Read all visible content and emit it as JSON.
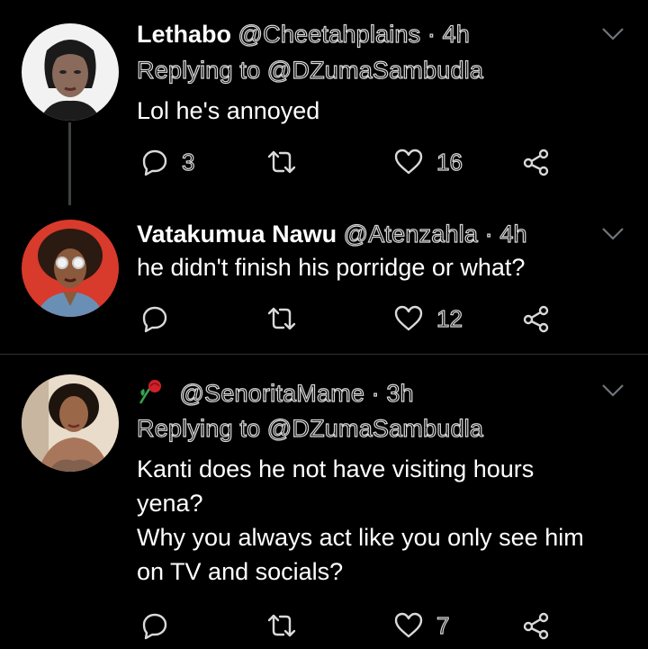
{
  "colors": {
    "background": "#000000",
    "text": "#ffffff",
    "icon": "#d9d9d9",
    "thread_line": "#3d4144"
  },
  "tweets": [
    {
      "display_name": "Lethabo",
      "handle": "@Cheetahplains",
      "separator": "·",
      "time": "4h",
      "replying_label": "Replying to",
      "replying_to": "@DZumaSambudla",
      "text": "Lol he's annoyed",
      "replies": "3",
      "retweets": "",
      "likes": "16"
    },
    {
      "display_name": "Vatakumua Nawu",
      "handle": "@Atenzahla",
      "separator": "·",
      "time": "4h",
      "text": "he didn't finish his porridge or what?",
      "replies": "",
      "retweets": "",
      "likes": "12"
    },
    {
      "display_name": "",
      "name_icon": "rose-emoji-icon",
      "handle": "@SenoritaMame",
      "separator": "·",
      "time": "3h",
      "replying_label": "Replying to",
      "replying_to": "@DZumaSambudla",
      "text_lines": [
        "Kanti does he not have visiting hours",
        "yena?",
        "Why you always act like you only see him",
        "on TV and socials?"
      ],
      "replies": "",
      "retweets": "",
      "likes": "7"
    }
  ]
}
